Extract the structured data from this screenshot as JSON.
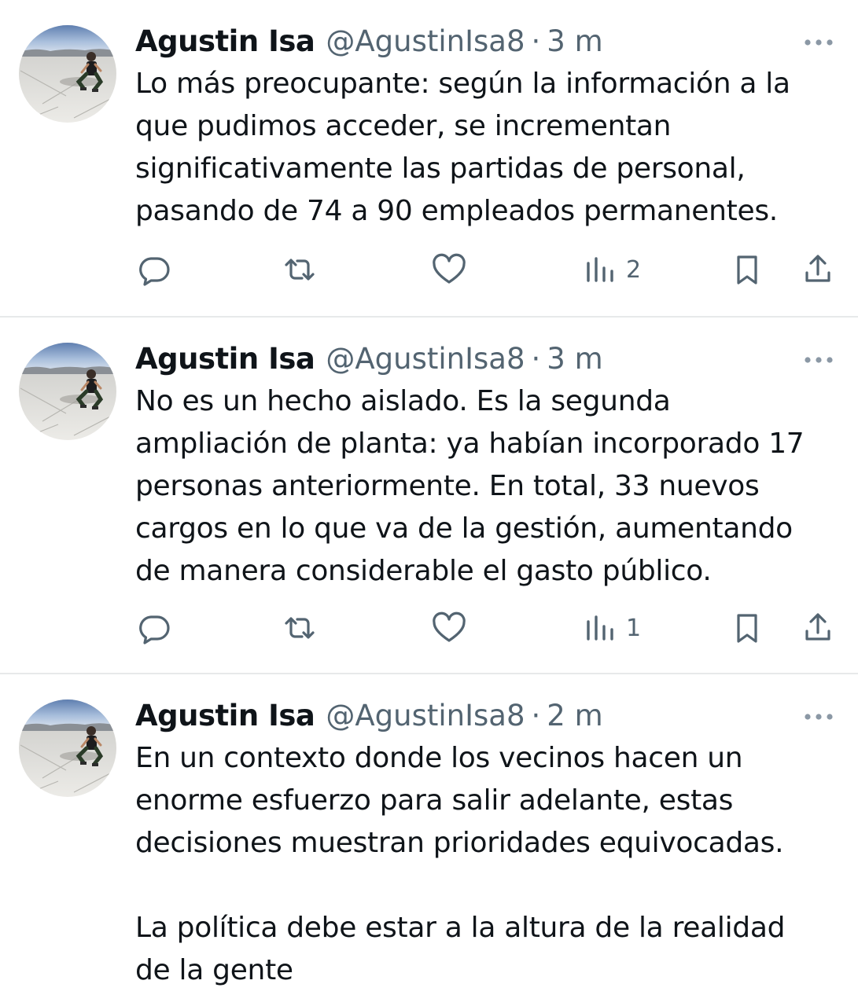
{
  "tweets": [
    {
      "author_name": "Agustin Isa",
      "handle": "@AgustinIsa8",
      "separator": "·",
      "time": "3 m",
      "text_lines": [
        "Lo más preocupante: según la información a la",
        "que pudimos acceder, se incrementan",
        "significativamente las partidas de personal,",
        "pasando de 74 a 90 empleados permanentes."
      ],
      "views": "2",
      "icons": {
        "reply": "comment-icon",
        "retweet": "retweet-icon",
        "like": "heart-icon",
        "views": "views-bar-chart-icon",
        "bookmark": "bookmark-icon",
        "share": "share-icon",
        "more": "more-dots-icon"
      }
    },
    {
      "author_name": "Agustin Isa",
      "handle": "@AgustinIsa8",
      "separator": "·",
      "time": "3 m",
      "text_lines": [
        "No es un hecho aislado. Es la segunda",
        "ampliación de planta: ya habían incorporado 17",
        "personas anteriormente. En total, 33 nuevos",
        "cargos en lo que va de la gestión, aumentando",
        "de manera considerable el gasto público."
      ],
      "views": "1"
    },
    {
      "author_name": "Agustin Isa",
      "handle": "@AgustinIsa8",
      "separator": "·",
      "time": "2 m",
      "paragraph1_lines": [
        "En un contexto donde los vecinos hacen un",
        "enorme esfuerzo para salir adelante, estas",
        "decisiones muestran prioridades equivocadas."
      ],
      "paragraph2_lines": [
        "La política debe estar a la altura de la realidad",
        "de la gente"
      ]
    }
  ],
  "colors": {
    "text_primary": "#0f1419",
    "text_secondary": "#536471",
    "divider": "#e7e9ea"
  }
}
